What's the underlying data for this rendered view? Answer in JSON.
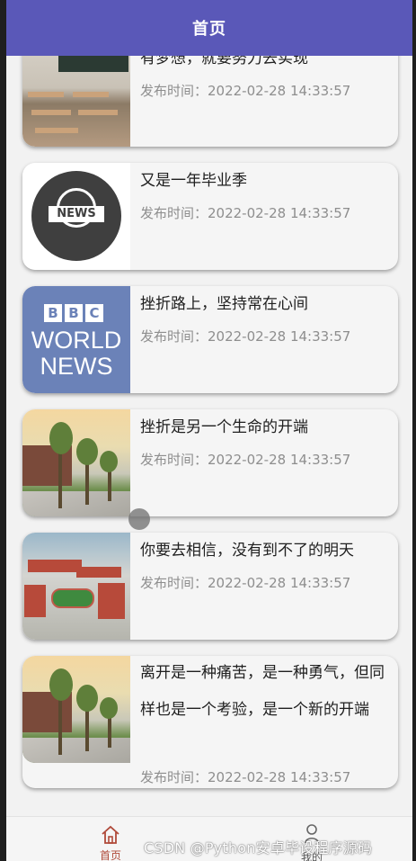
{
  "header": {
    "title": "首页"
  },
  "news": [
    {
      "title": "有梦想，就要努力去实现",
      "time": "发布时间：2022-02-28 14:33:57",
      "thumb": "classroom-image"
    },
    {
      "title": "又是一年毕业季",
      "time": "发布时间：2022-02-28 14:33:57",
      "thumb": "news-globe-image"
    },
    {
      "title": "挫折路上，坚持常在心间",
      "time": "发布时间：2022-02-28 14:33:57",
      "thumb": "bbc-world-news-image"
    },
    {
      "title": "挫折是另一个生命的开端",
      "time": "发布时间：2022-02-28 14:33:57",
      "thumb": "campus-trees-image"
    },
    {
      "title": "你要去相信，没有到不了的明天",
      "time": "发布时间：2022-02-28 14:33:57",
      "thumb": "campus-aerial-image"
    },
    {
      "title": "离开是一种痛苦，是一种勇气，但同样也是一个考验，是一个新的开端",
      "time": "发布时间：2022-02-28 14:33:57",
      "thumb": "campus-trees-image"
    }
  ],
  "thumb_text": {
    "news_badge": "NEWS",
    "bbc_letters": [
      "B",
      "B",
      "C"
    ],
    "world": "WORLD",
    "news": "NEWS"
  },
  "bottom_nav": {
    "home_label": "首页",
    "mine_label": "我的",
    "active_color": "#b04a3a"
  },
  "watermark": "CSDN @Python安卓毕设程序源码",
  "colors": {
    "header_bg": "#5a58b8",
    "card_bg": "#f5f5f5",
    "time_text": "#8e8e8e"
  }
}
